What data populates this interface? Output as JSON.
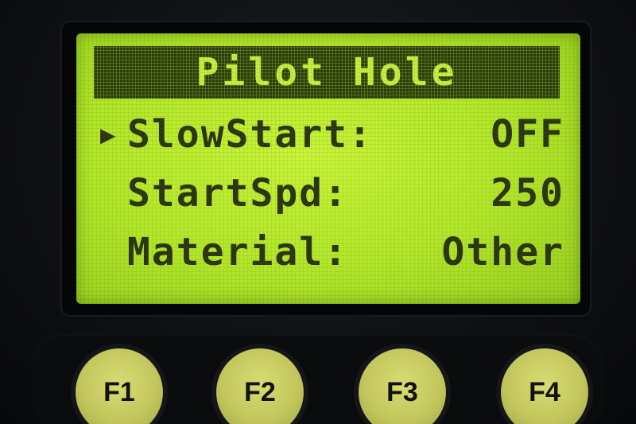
{
  "screen": {
    "title": "Pilot Hole",
    "cursor_glyph": "▶",
    "rows": [
      {
        "label": "SlowStart:",
        "value": "OFF",
        "selected": true
      },
      {
        "label": "StartSpd:",
        "value": "250",
        "selected": false
      },
      {
        "label": "Material:",
        "value": "Other",
        "selected": false
      }
    ]
  },
  "keys": [
    {
      "label": "F1"
    },
    {
      "label": "F2"
    },
    {
      "label": "F3"
    },
    {
      "label": "F4"
    }
  ],
  "colors": {
    "lcd_backlight": "#b8ea2e",
    "lcd_text": "#2b3514",
    "title_bar": "#2a3a10",
    "key_face": "#c6ca60"
  }
}
